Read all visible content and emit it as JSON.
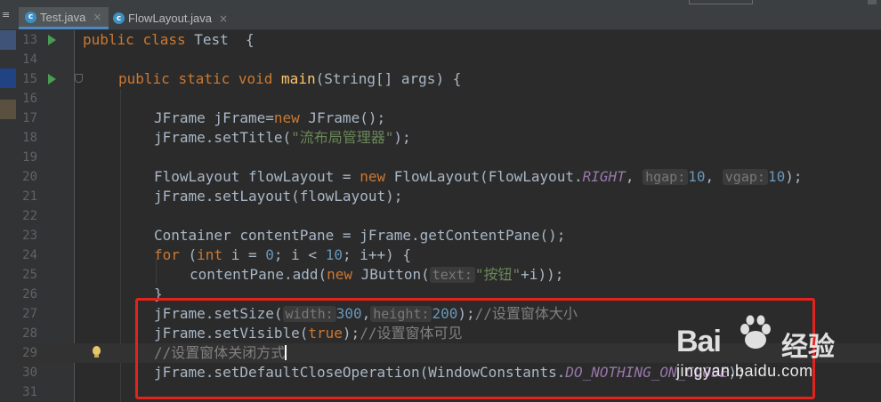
{
  "tabs": [
    {
      "label": "Test.java",
      "icon": "java-class-icon",
      "icon_letter": "c",
      "active": true
    },
    {
      "label": "FlowLayout.java",
      "icon": "java-class-icon",
      "icon_letter": "c",
      "active": false
    }
  ],
  "tab_close_glyph": "×",
  "lines": [
    {
      "n": "13"
    },
    {
      "n": "14"
    },
    {
      "n": "15"
    },
    {
      "n": "16"
    },
    {
      "n": "17"
    },
    {
      "n": "18"
    },
    {
      "n": "19"
    },
    {
      "n": "20"
    },
    {
      "n": "21"
    },
    {
      "n": "22"
    },
    {
      "n": "23"
    },
    {
      "n": "24"
    },
    {
      "n": "25"
    },
    {
      "n": "26"
    },
    {
      "n": "27"
    },
    {
      "n": "28"
    },
    {
      "n": "29"
    },
    {
      "n": "30"
    },
    {
      "n": "31"
    }
  ],
  "code": {
    "l13": {
      "k1": "public",
      "k2": "class",
      "name": "Test",
      "brace": " {"
    },
    "l15": {
      "k1": "public",
      "k2": "static",
      "k3": "void",
      "fn": "main",
      "rest": "(String[] args) {"
    },
    "l17": {
      "a": "JFrame jFrame=",
      "kw": "new",
      "b": " JFrame();"
    },
    "l18": {
      "a": "jFrame.setTitle(",
      "str": "\"流布局管理器\"",
      "b": ");"
    },
    "l20": {
      "a": "FlowLayout flowLayout = ",
      "kw": "new",
      "b": " FlowLayout(FlowLayout.",
      "it": "RIGHT",
      "c": ", ",
      "h1": "hgap:",
      "n1": "10",
      "d": ", ",
      "h2": "vgap:",
      "n2": "10",
      "e": ");"
    },
    "l21": {
      "a": "jFrame.setLayout(flowLayout);"
    },
    "l23": {
      "a": "Container contentPane = jFrame.getContentPane();"
    },
    "l24": {
      "kw1": "for",
      "a": " (",
      "kw2": "int",
      "b": " i = ",
      "n1": "0",
      "c": "; i < ",
      "n2": "10",
      "d": "; i++) {"
    },
    "l25": {
      "a": "contentPane.add(",
      "kw": "new",
      "b": " JButton(",
      "h": "text:",
      "str": "\"按钮\"",
      "c": "+i));"
    },
    "l26": {
      "a": "}"
    },
    "l27": {
      "a": "jFrame.setSize(",
      "h1": "width:",
      "n1": "300",
      "b": ",",
      "h2": "height:",
      "n2": "200",
      "c": ");",
      "cm": "//设置窗体大小"
    },
    "l28": {
      "a": "jFrame.setVisible(",
      "kw": "true",
      "b": ");",
      "cm": "//设置窗体可见"
    },
    "l29": {
      "cm": "//设置窗体关闭方式"
    },
    "l30": {
      "a": "jFrame.setDefaultCloseOperation(WindowConstants.",
      "it": "DO_NOTHING_ON_CLOSE",
      "b": ");"
    }
  },
  "watermark": {
    "brand": "Bai",
    "brand_cn": "经验",
    "url": "jingyan.baidu.com"
  },
  "colors": {
    "keyword": "#cc7832",
    "string": "#6a8759",
    "number": "#6897bb",
    "comment": "#808080",
    "highlight_box": "#e3231b"
  }
}
